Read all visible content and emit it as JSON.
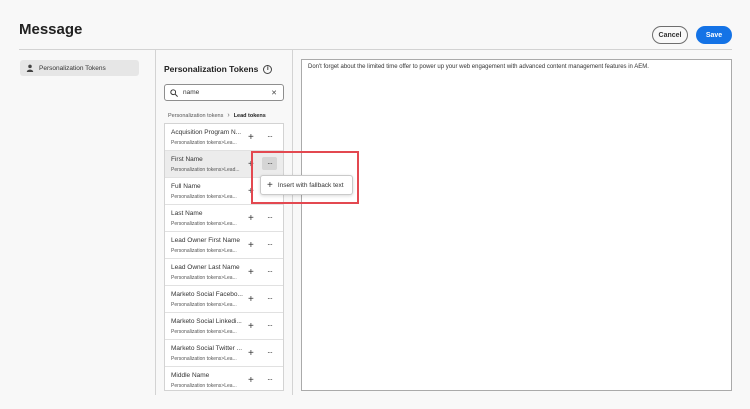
{
  "header": {
    "title": "Message",
    "cancel_label": "Cancel",
    "save_label": "Save"
  },
  "sidebar": {
    "items": [
      {
        "label": "Personalization Tokens",
        "icon": "user-icon"
      }
    ]
  },
  "tokens_panel": {
    "title": "Personalization Tokens",
    "info_icon": "info-icon",
    "search": {
      "value": "name",
      "icon": "search-icon",
      "clear_icon": "close-icon"
    },
    "breadcrumb": {
      "root": "Personalization tokens",
      "current": "Lead tokens"
    },
    "rows": [
      {
        "name": "Acquisition Program N...",
        "path": "Personalization tokens>Lea..."
      },
      {
        "name": "First Name",
        "path": "Personalization tokens>Lead...",
        "selected": true
      },
      {
        "name": "Full Name",
        "path": "Personalization tokens>Lea..."
      },
      {
        "name": "Last Name",
        "path": "Personalization tokens>Lea..."
      },
      {
        "name": "Lead Owner First Name",
        "path": "Personalization tokens>Lea..."
      },
      {
        "name": "Lead Owner Last Name",
        "path": "Personalization tokens>Lea..."
      },
      {
        "name": "Marketo Social Facebo...",
        "path": "Personalization tokens>Lea..."
      },
      {
        "name": "Marketo Social Linkedi...",
        "path": "Personalization tokens>Lea..."
      },
      {
        "name": "Marketo Social Twitter ...",
        "path": "Personalization tokens>Lea..."
      },
      {
        "name": "Middle Name",
        "path": "Personalization tokens>Lea..."
      }
    ],
    "add_glyph": "+",
    "more_glyph": "···"
  },
  "popover": {
    "label": "Insert with fallback text",
    "plus_glyph": "+"
  },
  "editor": {
    "content": "Don't forget about the limited time offer to power up your web engagement with advanced content management features in AEM."
  },
  "colors": {
    "accent": "#1473e6",
    "highlight": "#e34850"
  }
}
